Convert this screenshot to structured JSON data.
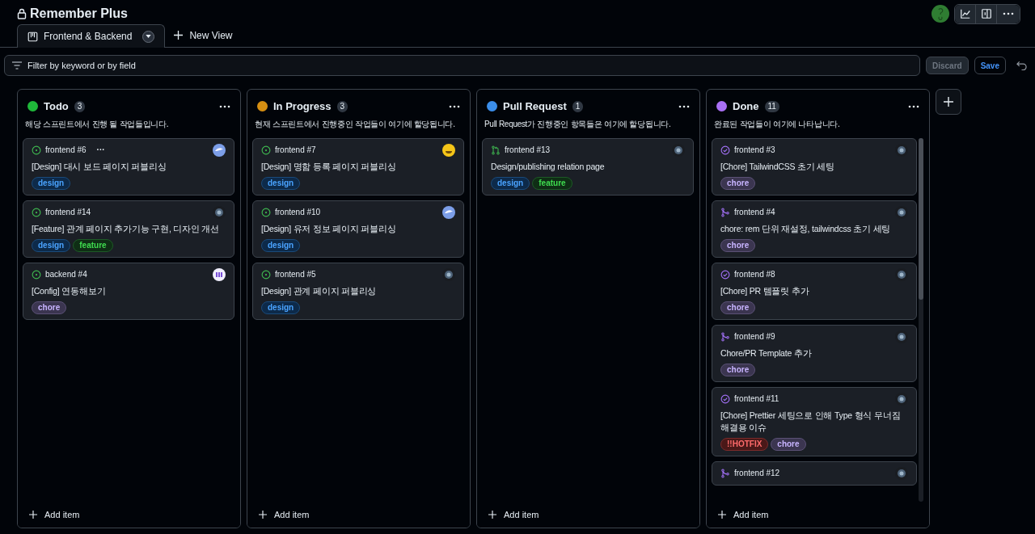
{
  "project": {
    "title": "Remember Plus"
  },
  "views": [
    {
      "label": "Frontend & Backend",
      "selected": true
    }
  ],
  "new_view": "New View",
  "filter": {
    "placeholder": "Filter by keyword or by field"
  },
  "actions": {
    "discard": "Discard",
    "save": "Save"
  },
  "columns": [
    {
      "name": "Todo",
      "color": "#1fb83a",
      "count": "3",
      "description": "해당 스프린트에서 진행 될 작업들입니다.",
      "add_item": "Add item",
      "items": [
        {
          "kind": "issue-open",
          "ref": "frontend #6",
          "menu": "···",
          "avatar": {
            "kind": "bird"
          },
          "title": "[Design] 대시 보드 페이지 퍼블리싱",
          "labels": [
            {
              "kind": "design",
              "text": "design"
            }
          ]
        },
        {
          "kind": "issue-open",
          "ref": "frontend #14",
          "avatar": {
            "kind": "camera"
          },
          "title": "[Feature] 관계 페이지 추가기능 구현, 디자인 개선",
          "labels": [
            {
              "kind": "design",
              "text": "design"
            },
            {
              "kind": "feature",
              "text": "feature"
            }
          ]
        },
        {
          "kind": "issue-open",
          "ref": "backend #4",
          "avatar": {
            "kind": "pattern"
          },
          "title": "[Config] 연동해보기",
          "labels": [
            {
              "kind": "chore",
              "text": "chore"
            }
          ]
        }
      ]
    },
    {
      "name": "In Progress",
      "color": "#d68f12",
      "count": "3",
      "description": "현재 스프린트에서 진행중인 작업들이 여기에 할당됩니다.",
      "add_item": "Add item",
      "items": [
        {
          "kind": "issue-open",
          "ref": "frontend #7",
          "avatar": {
            "kind": "emoji"
          },
          "title": "[Design] 명함 등록 페이지 퍼블리싱",
          "labels": [
            {
              "kind": "design",
              "text": "design"
            }
          ]
        },
        {
          "kind": "issue-open",
          "ref": "frontend #10",
          "avatar": {
            "kind": "bird"
          },
          "title": "[Design] 유저 정보 페이지 퍼블리싱",
          "labels": [
            {
              "kind": "design",
              "text": "design"
            }
          ]
        },
        {
          "kind": "issue-open",
          "ref": "frontend #5",
          "avatar": {
            "kind": "camera"
          },
          "title": "[Design] 관계 페이지 퍼블리싱",
          "labels": [
            {
              "kind": "design",
              "text": "design"
            }
          ]
        }
      ]
    },
    {
      "name": "Pull Request",
      "color": "#3b8eea",
      "count": "1",
      "description": "Pull Request가 진행중인 항목들은 여기에 할당됩니다.",
      "add_item": "Add item",
      "items": [
        {
          "kind": "pr-open",
          "ref": "frontend #13",
          "avatar": {
            "kind": "camera"
          },
          "title": "Design/publishing relation page",
          "labels": [
            {
              "kind": "design",
              "text": "design"
            },
            {
              "kind": "feature",
              "text": "feature"
            }
          ]
        }
      ]
    },
    {
      "name": "Done",
      "color": "#a970f5",
      "count": "11",
      "description": "완료된 작업들이 여기에 나타납니다.",
      "add_item": "Add item",
      "items": [
        {
          "kind": "issue-closed",
          "ref": "frontend #3",
          "avatar": {
            "kind": "camera"
          },
          "title": "[Chore] TailwindCSS 초기 세팅",
          "labels": [
            {
              "kind": "chore",
              "text": "chore"
            }
          ]
        },
        {
          "kind": "pr-merged",
          "ref": "frontend #4",
          "avatar": {
            "kind": "camera"
          },
          "title": "chore: rem 단위 재설정, tailwindcss 초기 세팅",
          "labels": [
            {
              "kind": "chore",
              "text": "chore"
            }
          ]
        },
        {
          "kind": "issue-closed",
          "ref": "frontend #8",
          "avatar": {
            "kind": "camera"
          },
          "title": "[Chore] PR 템플릿 추가",
          "labels": [
            {
              "kind": "chore",
              "text": "chore"
            }
          ]
        },
        {
          "kind": "pr-merged",
          "ref": "frontend #9",
          "avatar": {
            "kind": "camera"
          },
          "title": "Chore/PR Template 추가",
          "labels": [
            {
              "kind": "chore",
              "text": "chore"
            }
          ]
        },
        {
          "kind": "issue-closed",
          "ref": "frontend #11",
          "avatar": {
            "kind": "camera"
          },
          "title": "[Chore] Prettier 세팅으로 인해 Type 형식 무너짐 해결용 이슈",
          "labels": [
            {
              "kind": "hotfix",
              "text": "!!HOTFIX"
            },
            {
              "kind": "chore",
              "text": "chore"
            }
          ]
        },
        {
          "kind": "pr-merged",
          "ref": "frontend #12",
          "avatar": {
            "kind": "camera"
          }
        }
      ]
    }
  ]
}
